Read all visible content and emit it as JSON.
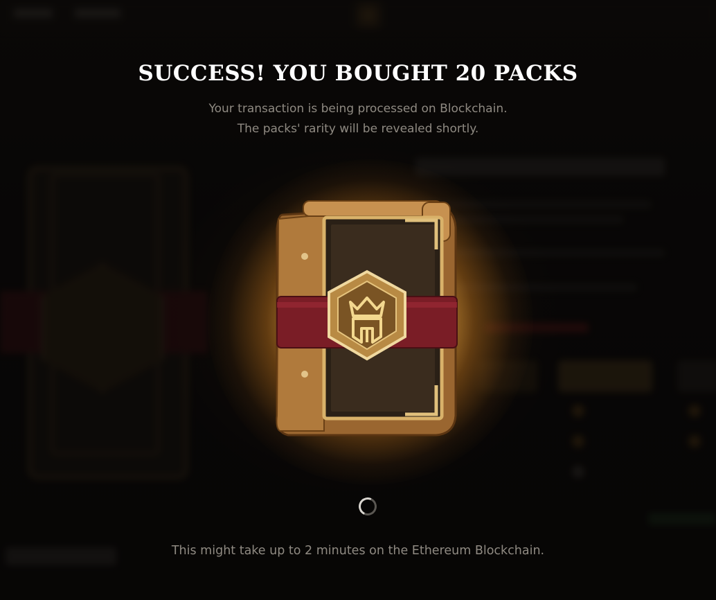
{
  "dialog": {
    "title": "SUCCESS! YOU BOUGHT 20 PACKS",
    "subtitle_line1": "Your transaction is being processed on Blockchain.",
    "subtitle_line2": "The packs' rarity will be revealed shortly.",
    "footnote": "This might take up to 2 minutes on the Ethereum Blockchain."
  },
  "icons": {
    "pack": "card-pack-icon",
    "emblem": "spartan-helmet-icon",
    "spinner": "loading-spinner-icon"
  },
  "colors": {
    "title": "#ffffff",
    "subtitle": "#8f8a82",
    "glow": "#ffc866",
    "strap": "#7a1d26",
    "leather": "#8a5a2b"
  }
}
